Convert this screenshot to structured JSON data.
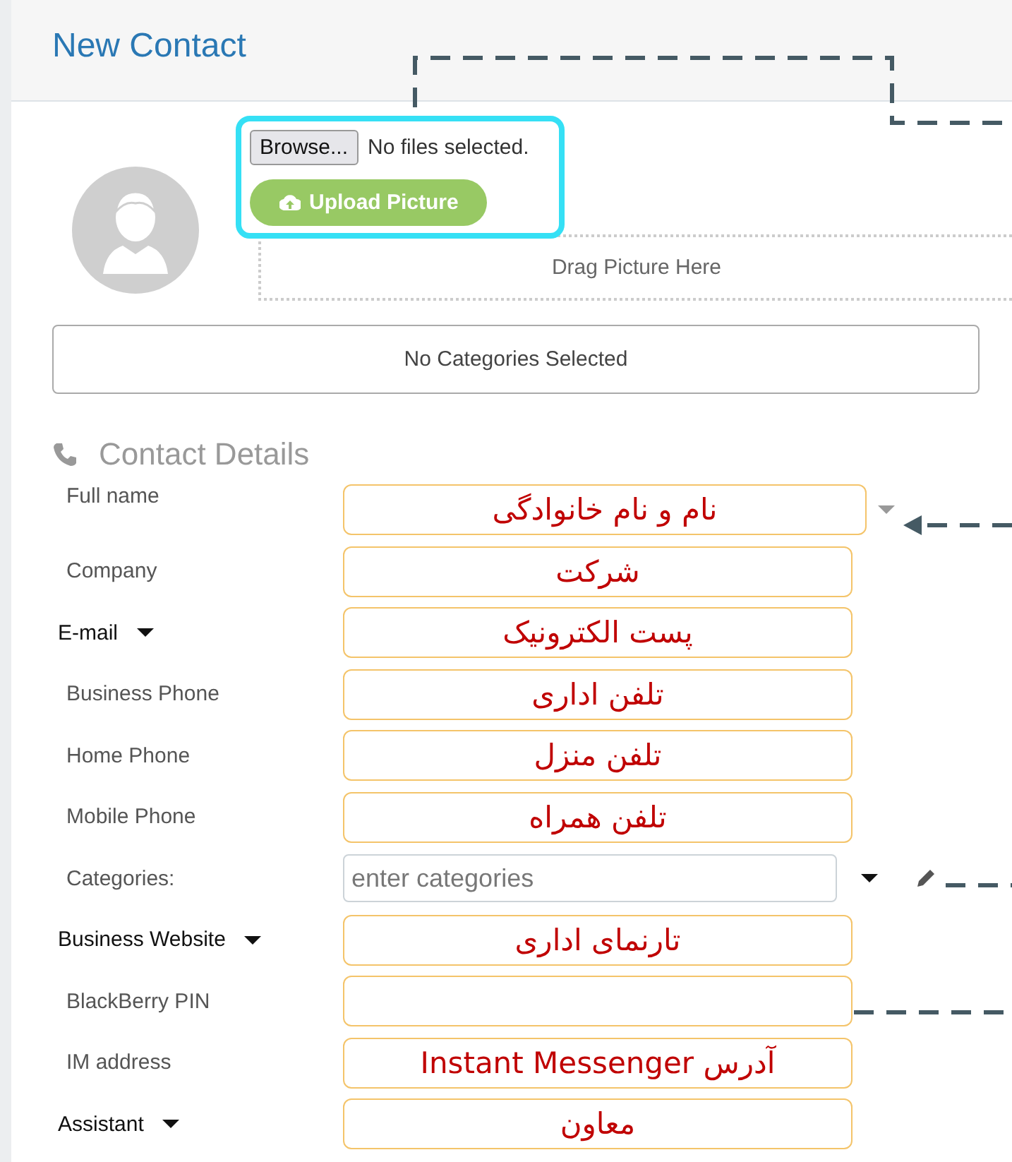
{
  "header": {
    "title": "New Contact"
  },
  "picture_upload": {
    "browse_button": "Browse...",
    "file_status": "No files selected.",
    "upload_button": "Upload Picture",
    "drop_zone": "Drag Picture Here"
  },
  "categories_summary": "No Categories Selected",
  "section": {
    "title": "Contact Details"
  },
  "rows": [
    {
      "kind": "name",
      "label": "Full name",
      "label_menu": false,
      "value": "نام و نام خانوادگی"
    },
    {
      "kind": "text",
      "label": "Company",
      "label_menu": false,
      "value": "شرکت"
    },
    {
      "kind": "text",
      "label": "E-mail",
      "label_menu": true,
      "value": "پست الکترونیک"
    },
    {
      "kind": "text",
      "label": "Business Phone",
      "label_menu": false,
      "value": "تلفن اداری"
    },
    {
      "kind": "text",
      "label": "Home Phone",
      "label_menu": false,
      "value": "تلفن منزل"
    },
    {
      "kind": "text",
      "label": "Mobile Phone",
      "label_menu": false,
      "value": "تلفن همراه"
    },
    {
      "kind": "categories",
      "label": "Categories:",
      "label_menu": false,
      "placeholder": "enter categories"
    },
    {
      "kind": "text",
      "label": "Business Website",
      "label_menu": true,
      "value": "تارنمای اداری"
    },
    {
      "kind": "text",
      "label": "BlackBerry PIN",
      "label_menu": false
    },
    {
      "kind": "text",
      "label": "IM address",
      "label_menu": false,
      "value": "آدرس Instant Messenger"
    },
    {
      "kind": "text",
      "label": "Assistant",
      "label_menu": true,
      "value": "معاون"
    }
  ]
}
